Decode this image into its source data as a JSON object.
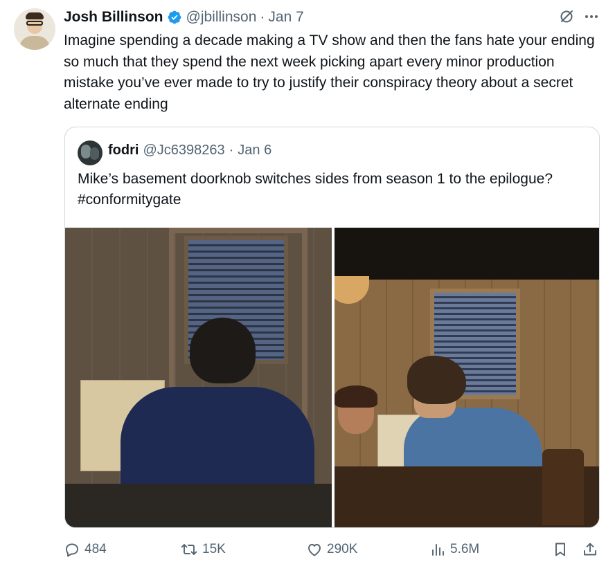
{
  "tweet": {
    "author": {
      "name": "Josh Billinson",
      "handle": "@jbillinson",
      "verified": true,
      "avatar_icon": "profile-photo"
    },
    "separator": "·",
    "date": "Jan 7",
    "text": "Imagine spending a decade making a TV show and then the fans hate your ending so much that they spend the next week picking apart every minor production mistake you’ve ever made to try to justify their conspiracy theory about a secret alternate ending",
    "quoted": {
      "author": {
        "name": "fodri",
        "handle": "@Jc6398263"
      },
      "separator": "·",
      "date": "Jan 6",
      "text": "Mike’s basement doorknob switches sides from season 1 to the epilogue? #conformitygate",
      "images": [
        "basement-scene-season-1",
        "basement-scene-epilogue"
      ]
    },
    "metrics": {
      "replies": "484",
      "reposts": "15K",
      "likes": "290K",
      "views": "5.6M"
    }
  },
  "colors": {
    "text": "#0f1419",
    "secondary": "#536471",
    "verified": "#1d9bf0",
    "border": "#cfd9de"
  }
}
